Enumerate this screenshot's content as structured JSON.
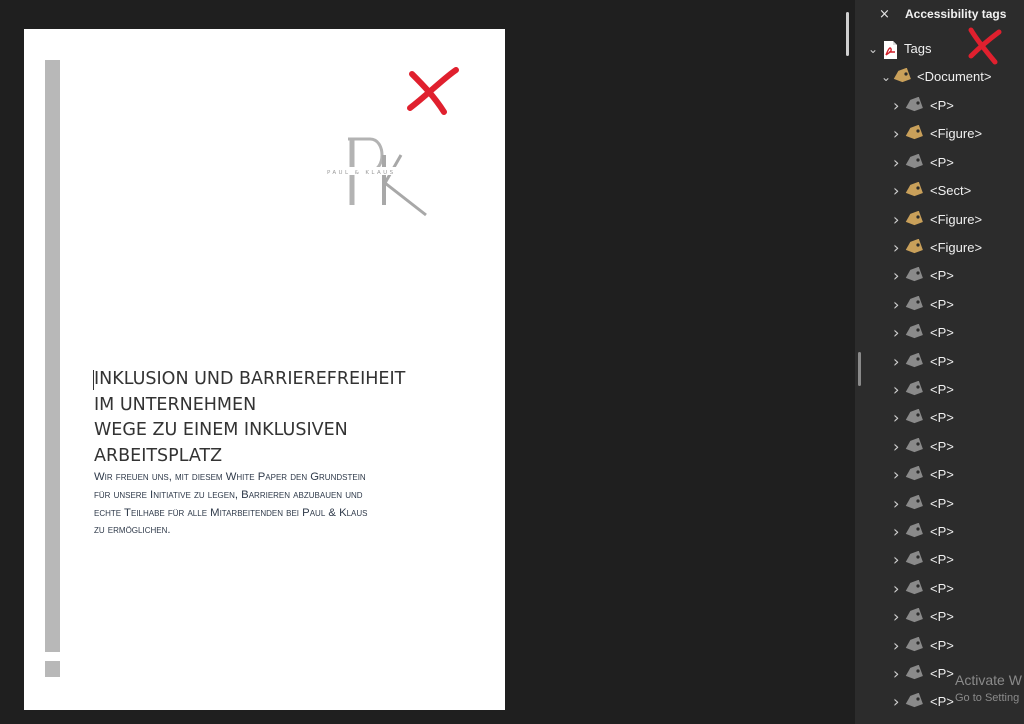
{
  "document": {
    "logo_text": "PAUL & KLAUS",
    "title_lines": [
      "Inklusion und Barrierefreiheit",
      "im Unternehmen",
      "Wege zu einem inklusiven",
      "Arbeitsplatz"
    ],
    "intro_lines": [
      "Wir freuen uns, mit diesem White Paper den Grundstein",
      "für unsere Initiative zu legen, Barrieren abzubauen und",
      "echte Teilhabe für alle Mitarbeitenden bei Paul & Klaus",
      "zu ermöglichen."
    ]
  },
  "panel": {
    "close_label": "×",
    "title": "Accessibility tags",
    "root": {
      "label": "Tags",
      "icon": "pdf-file-icon"
    },
    "document_node": {
      "label": "<Document>",
      "icon": "tag-icon"
    },
    "children": [
      {
        "label": "<P>",
        "type": "P"
      },
      {
        "label": "<Figure>",
        "type": "Figure"
      },
      {
        "label": "<P>",
        "type": "P"
      },
      {
        "label": "<Sect>",
        "type": "Sect"
      },
      {
        "label": "<Figure>",
        "type": "Figure"
      },
      {
        "label": "<Figure>",
        "type": "Figure"
      },
      {
        "label": "<P>",
        "type": "P"
      },
      {
        "label": "<P>",
        "type": "P"
      },
      {
        "label": "<P>",
        "type": "P"
      },
      {
        "label": "<P>",
        "type": "P"
      },
      {
        "label": "<P>",
        "type": "P"
      },
      {
        "label": "<P>",
        "type": "P"
      },
      {
        "label": "<P>",
        "type": "P"
      },
      {
        "label": "<P>",
        "type": "P"
      },
      {
        "label": "<P>",
        "type": "P"
      },
      {
        "label": "<P>",
        "type": "P"
      },
      {
        "label": "<P>",
        "type": "P"
      },
      {
        "label": "<P>",
        "type": "P"
      },
      {
        "label": "<P>",
        "type": "P"
      },
      {
        "label": "<P>",
        "type": "P"
      },
      {
        "label": "<P>",
        "type": "P"
      },
      {
        "label": "<P>",
        "type": "P"
      }
    ],
    "watermark_line1": "Activate W",
    "watermark_line2": "Go to Setting"
  },
  "colors": {
    "annotation_red": "#e0202e",
    "tag_gold": "#c9a05a",
    "tag_gray": "#8a8a8a"
  }
}
